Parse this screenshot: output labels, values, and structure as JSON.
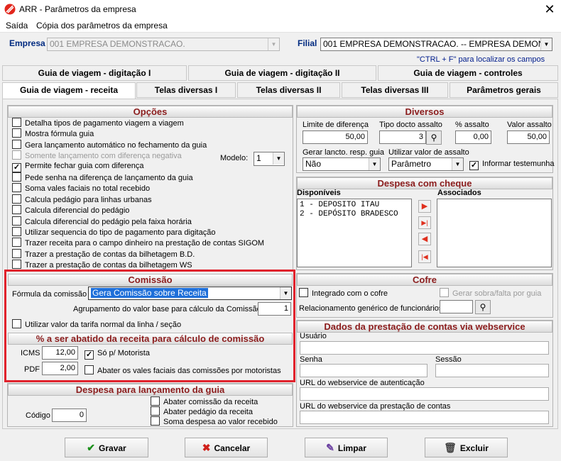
{
  "window": {
    "title": "ARR - Parâmetros da empresa",
    "close": "✕"
  },
  "menu": [
    "Saída",
    "Cópia dos parâmetros da empresa"
  ],
  "header": {
    "empresa_label": "Empresa",
    "empresa_value": "001 EMPRESA DEMONSTRACAO.",
    "filial_label": "Filial",
    "filial_value": "001 EMPRESA DEMONSTRACAO. -- EMPRESA DEMONSTRA",
    "hint": "\"CTRL + F\" para localizar os campos"
  },
  "tabs_row1": [
    "Guia de viagem - digitação I",
    "Guia de viagem - digitação II",
    "Guia de viagem - controles"
  ],
  "tabs_row2": [
    "Guia de viagem - receita",
    "Telas diversas I",
    "Telas diversas II",
    "Telas diversas III",
    "Parâmetros gerais"
  ],
  "opcoes": {
    "title": "Opções",
    "items": [
      {
        "label": "Detalha tipos de pagamento viagem a viagem",
        "checked": "",
        "disabled": false
      },
      {
        "label": "Mostra fórmula guia",
        "checked": "",
        "disabled": false
      },
      {
        "label": "Gera lançamento automático no fechamento da guia",
        "checked": "",
        "disabled": false
      },
      {
        "label": "Somente lançamento com diferença negativa",
        "checked": "",
        "disabled": true
      },
      {
        "label": "Permite fechar guia com diferença",
        "checked": "✓",
        "disabled": false
      },
      {
        "label": "Pede senha na diferença de lançamento da guia",
        "checked": "",
        "disabled": false
      },
      {
        "label": "Soma vales faciais no total recebido",
        "checked": "",
        "disabled": false
      },
      {
        "label": "Calcula pedágio para linhas urbanas",
        "checked": "",
        "disabled": false
      },
      {
        "label": "Calcula diferencial do pedágio",
        "checked": "",
        "disabled": false
      },
      {
        "label": "Calcula diferencial do pedágio pela faixa horária",
        "checked": "",
        "disabled": false
      },
      {
        "label": "Utilizar sequencia do tipo de pagamento para digitação",
        "checked": "",
        "disabled": false
      },
      {
        "label": "Trazer receita para o campo dinheiro na prestação de contas SIGOM",
        "checked": "",
        "disabled": false
      },
      {
        "label": "Trazer a prestação de contas da bilhetagem B.D.",
        "checked": "",
        "disabled": false
      },
      {
        "label": "Trazer a prestação de contas da bilhetagem WS",
        "checked": "",
        "disabled": false
      }
    ],
    "modelo_label": "Modelo:",
    "modelo_value": "1"
  },
  "diversos": {
    "title": "Diversos",
    "limite_label": "Limite de diferença",
    "limite_value": "50,00",
    "tipo_label": "Tipo docto assalto",
    "tipo_value": "3",
    "pct_label": "% assalto",
    "pct_value": "0,00",
    "valor_label": "Valor assalto",
    "valor_value": "50,00",
    "gerar_label": "Gerar lancto. resp. guia",
    "gerar_value": "Não",
    "utilizar_label": "Utilizar valor de assalto",
    "utilizar_value": "Parâmetro",
    "informar_label": "Informar testemunha",
    "informar_checked": "✓"
  },
  "cheque": {
    "title": "Despesa com cheque",
    "disponiveis_label": "Disponíveis",
    "associados_label": "Associados",
    "disponiveis": [
      "1 - DEPOSITO ITAU",
      "2 - DEPÓSITO BRADESCO"
    ],
    "buttons": [
      "▶",
      "▶|",
      "◀",
      "|◀"
    ]
  },
  "comissao": {
    "title": "Comissão",
    "formula_label": "Fórmula da comissão",
    "formula_value": "Gera Comissão sobre  Receita",
    "agrup_label": "Agrupamento do valor base para cálculo da Comissão",
    "agrup_value": "1",
    "tarifa_label": "Utilizar valor da tarifa normal da linha / seção"
  },
  "abatido": {
    "title": "% a ser abatido da receita para cálculo de comissão",
    "icms_label": "ICMS",
    "icms_value": "12,00",
    "so_motorista_label": "Só p/ Motorista",
    "so_motorista_checked": "✓",
    "pdf_label": "PDF",
    "pdf_value": "2,00",
    "abater_label": "Abater os vales faciais das comissões por motoristas"
  },
  "despesa": {
    "title": "Despesa para lançamento da guia",
    "items": [
      "Abater comissão da receita",
      "Abater pedágio da receita",
      "Soma despesa ao valor recebido"
    ],
    "codigo_label": "Código",
    "codigo_value": "0"
  },
  "cofre": {
    "title": "Cofre",
    "integrado_label": "Integrado com o cofre",
    "gerar_label": "Gerar sobra/falta por guia",
    "relac_label": "Relacionamento genérico de funcionários"
  },
  "webservice": {
    "title": "Dados da prestação de contas via webservice",
    "usuario_label": "Usuário",
    "senha_label": "Senha",
    "sessao_label": "Sessão",
    "auth_label": "URL do webservice de autenticação",
    "prest_label": "URL do webservice da prestação de contas"
  },
  "buttons": {
    "gravar": "Gravar",
    "cancelar": "Cancelar",
    "limpar": "Limpar",
    "excluir": "Excluir"
  },
  "colors": {
    "section_title": "#8b1c1c",
    "highlight_box": "#e0222c",
    "selection": "#1e6fd9",
    "label_blue": "#002a80"
  }
}
